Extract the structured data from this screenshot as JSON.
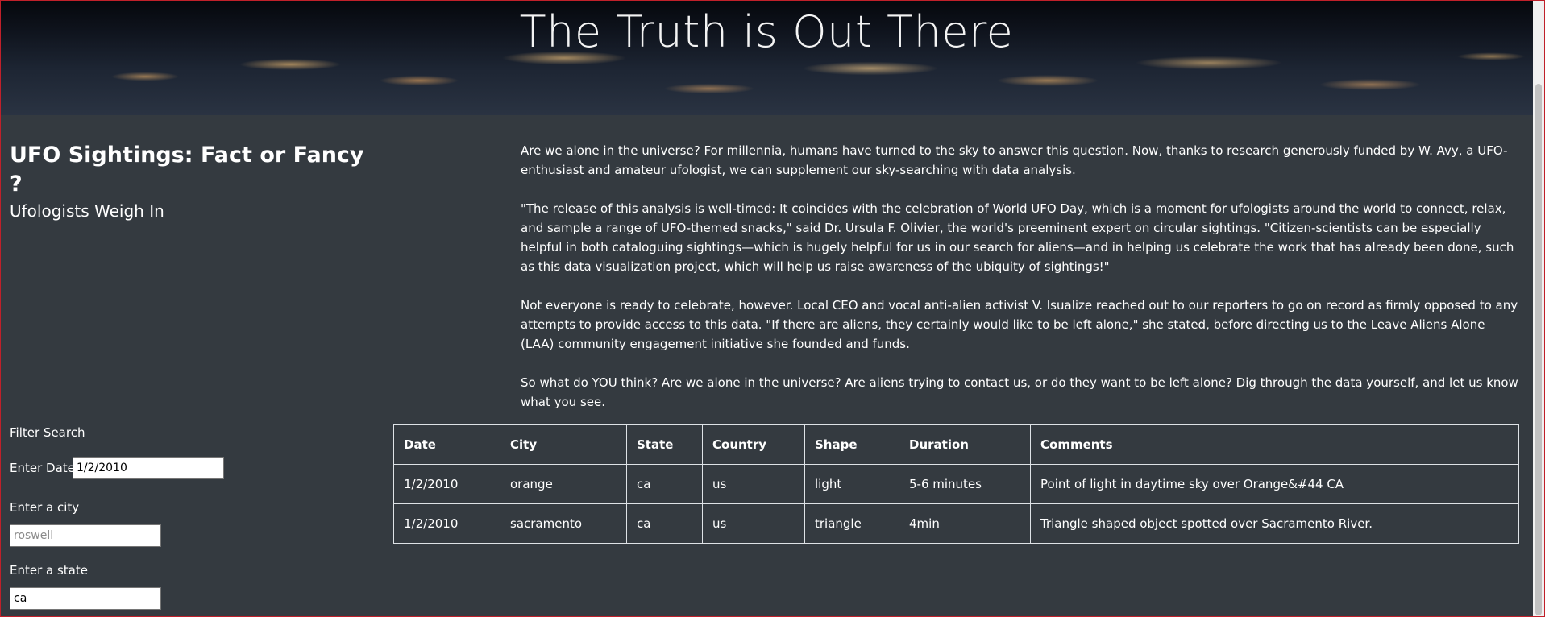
{
  "hero": {
    "title": "The Truth is Out There"
  },
  "heading": {
    "title": "UFO Sightings: Fact or Fancy ?",
    "subtitle": "Ufologists Weigh In"
  },
  "article": {
    "paragraphs": [
      "Are we alone in the universe? For millennia, humans have turned to the sky to answer this question. Now, thanks to research generously funded by W. Avy, a UFO-enthusiast and amateur ufologist, we can supplement our sky-searching with data analysis.",
      "\"The release of this analysis is well-timed: It coincides with the celebration of World UFO Day, which is a moment for ufologists around the world to connect, relax, and sample a range of UFO-themed snacks,\" said Dr. Ursula F. Olivier, the world's preeminent expert on circular sightings. \"Citizen-scientists can be especially helpful in both cataloguing sightings—which is hugely helpful for us in our search for aliens—and in helping us celebrate the work that has already been done, such as this data visualization project, which will help us raise awareness of the ubiquity of sightings!\"",
      "Not everyone is ready to celebrate, however. Local CEO and vocal anti-alien activist V. Isualize reached out to our reporters to go on record as firmly opposed to any attempts to provide access to this data. \"If there are aliens, they certainly would like to be left alone,\" she stated, before directing us to the Leave Aliens Alone (LAA) community engagement initiative she founded and funds.",
      "So what do YOU think? Are we alone in the universe? Are aliens trying to contact us, or do they want to be left alone? Dig through the data yourself, and let us know what you see."
    ]
  },
  "filters": {
    "title": "Filter Search",
    "date": {
      "label": "Enter Date",
      "value": "1/2/2010"
    },
    "city": {
      "label": "Enter a city",
      "placeholder": "roswell",
      "value": ""
    },
    "state": {
      "label": "Enter a state",
      "value": "ca"
    }
  },
  "table": {
    "headers": [
      "Date",
      "City",
      "State",
      "Country",
      "Shape",
      "Duration",
      "Comments"
    ],
    "rows": [
      [
        "1/2/2010",
        "orange",
        "ca",
        "us",
        "light",
        "5-6 minutes",
        "Point of light in daytime sky over Orange&#44 CA"
      ],
      [
        "1/2/2010",
        "sacramento",
        "ca",
        "us",
        "triangle",
        "4min",
        "Triangle shaped object spotted over Sacramento River."
      ]
    ]
  }
}
